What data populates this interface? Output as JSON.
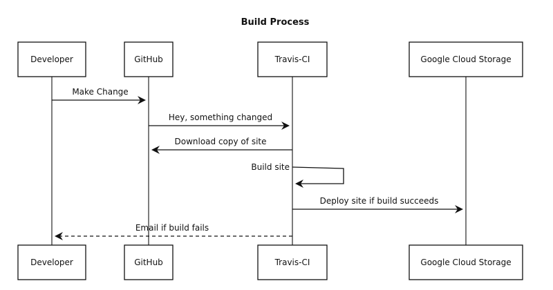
{
  "title": "Build Process",
  "participants": [
    {
      "id": "developer",
      "label": "Developer"
    },
    {
      "id": "github",
      "label": "GitHub"
    },
    {
      "id": "travis",
      "label": "Travis-CI"
    },
    {
      "id": "gcs",
      "label": "Google Cloud Storage"
    }
  ],
  "messages": [
    {
      "from": "developer",
      "to": "github",
      "label": "Make Change",
      "style": "solid"
    },
    {
      "from": "github",
      "to": "travis",
      "label": "Hey, something changed",
      "style": "solid"
    },
    {
      "from": "travis",
      "to": "github",
      "label": "Download copy of site",
      "style": "solid"
    },
    {
      "from": "travis",
      "to": "travis",
      "label": "Build site",
      "style": "solid"
    },
    {
      "from": "travis",
      "to": "gcs",
      "label": "Deploy site if build succeeds",
      "style": "solid"
    },
    {
      "from": "travis",
      "to": "developer",
      "label": "Email if build fails",
      "style": "dashed"
    }
  ],
  "colors": {
    "stroke": "#111111",
    "box_fill": "#ffffff"
  }
}
